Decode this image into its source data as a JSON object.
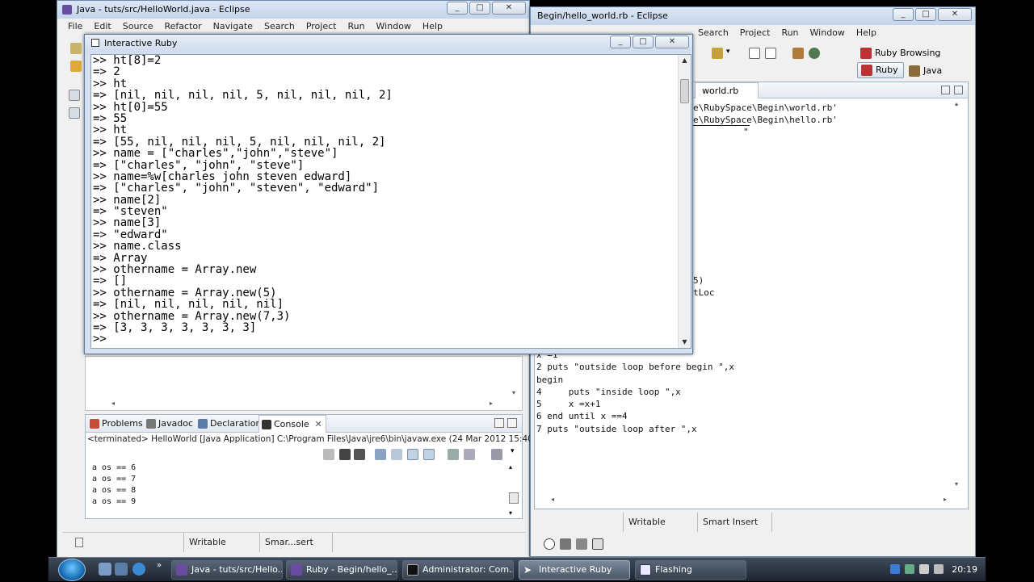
{
  "java_window": {
    "title": "Java - tuts/src/HelloWorld.java - Eclipse",
    "menu": [
      "File",
      "Edit",
      "Source",
      "Refactor",
      "Navigate",
      "Search",
      "Project",
      "Run",
      "Window",
      "Help"
    ],
    "bottom_tabs": [
      "Problems",
      "Javadoc",
      "Declaration",
      "Console"
    ],
    "console_header": "<terminated> HelloWorld [Java Application] C:\\Program Files\\Java\\jre6\\bin\\javaw.exe (24 Mar 2012 15:40:40)",
    "console_lines": [
      "a os == 6",
      "a os == 7",
      "a os == 8",
      "a os == 9"
    ],
    "status": {
      "writable": "Writable",
      "insert": "Smar...sert"
    }
  },
  "ruby_window": {
    "title": "Begin/hello_world.rb - Eclipse",
    "menu": [
      "Search",
      "Project",
      "Run",
      "Window",
      "Help"
    ],
    "perspectives": {
      "ruby_browsing": "Ruby Browsing",
      "ruby": "Ruby",
      "java": "Java"
    },
    "editor_tab": "world.rb",
    "editor_top_lines": [
      "e\\RubySpace\\Begin\\world.rb'",
      "e\\RubySpace\\Begin\\hello.rb'",
      "\""
    ],
    "editor_mid_lines": [
      "5)",
      "tLoc"
    ],
    "code_lines": [
      "x =1",
      "2 puts \"outside loop before begin \",x",
      "begin",
      "4     puts \"inside loop \",x",
      "5     x =x+1",
      "6 end until x ==4",
      "7 puts \"outside loop after \",x"
    ],
    "status": {
      "writable": "Writable",
      "insert": "Smart Insert"
    }
  },
  "irb_window": {
    "title": "Interactive Ruby",
    "lines": [
      ">> ht[8]=2",
      "=> 2",
      ">> ht",
      "=> [nil, nil, nil, nil, 5, nil, nil, nil, 2]",
      ">> ht[0]=55",
      "=> 55",
      ">> ht",
      "=> [55, nil, nil, nil, 5, nil, nil, nil, 2]",
      ">> name = [\"charles\",\"john\",\"steve\"]",
      "=> [\"charles\", \"john\", \"steve\"]",
      ">> name=%w[charles john steven edward]",
      "=> [\"charles\", \"john\", \"steven\", \"edward\"]",
      ">> name[2]",
      "=> \"steven\"",
      ">> name[3]",
      "=> \"edward\"",
      ">> name.class",
      "=> Array",
      ">> othername = Array.new",
      "=> []",
      ">> othername = Array.new(5)",
      "=> [nil, nil, nil, nil, nil]",
      ">> othername = Array.new(7,3)",
      "=> [3, 3, 3, 3, 3, 3, 3]",
      ">>"
    ]
  },
  "taskbar": {
    "buttons": [
      "Java - tuts/src/Hello...",
      "Ruby - Begin/hello_...",
      "Administrator: Com...",
      "Interactive Ruby",
      "Flashing"
    ],
    "clock": "20:19"
  },
  "colors": {
    "irb_prompt_bg": "#ffffff",
    "taskbar": "#2a3340",
    "accent": "#3b6ea5"
  }
}
